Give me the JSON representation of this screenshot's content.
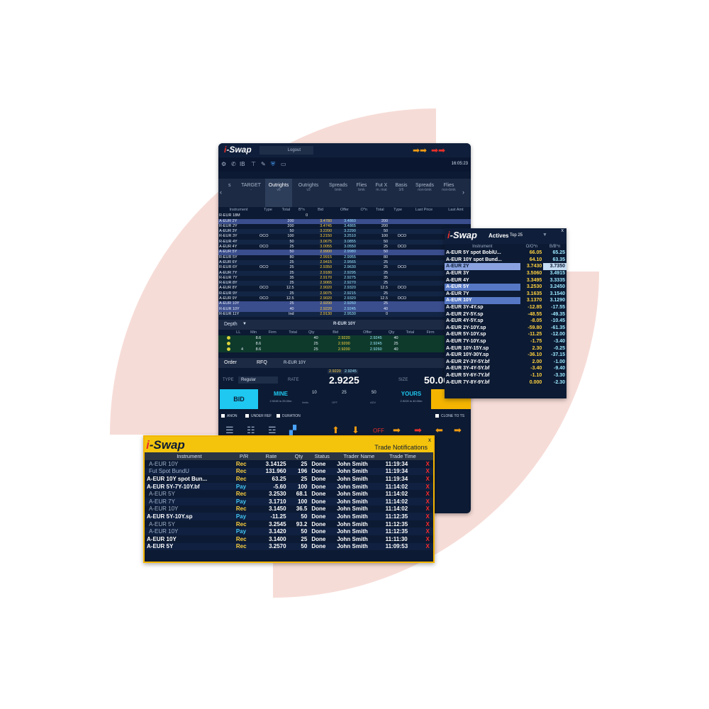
{
  "main": {
    "logo": {
      "i": "i",
      "rest": "-Swap"
    },
    "logout_label": "Logout",
    "clock": "16:05:23",
    "tabs": [
      {
        "label": "s",
        "sub": ""
      },
      {
        "label": "TARGET",
        "sub": "-"
      },
      {
        "label": "Outrights",
        "sub": "v6"
      },
      {
        "label": "Outrights",
        "sub": "v3"
      },
      {
        "label": "Spreads",
        "sub": "bmk"
      },
      {
        "label": "Flies",
        "sub": "bmk"
      },
      {
        "label": "Fut X",
        "sub": "m. mat"
      },
      {
        "label": "Basis",
        "sub": "3/6"
      },
      {
        "label": "Spreads",
        "sub": "non-bmk"
      },
      {
        "label": "Flies",
        "sub": "non-bmk"
      }
    ],
    "grid_headers": [
      "Instrument",
      "Type",
      "Total",
      "B*n",
      "Bid",
      "Offer",
      "O*n",
      "Total",
      "Type",
      "Last Price",
      "Last Amt"
    ],
    "grid_rows": [
      [
        "R-EUR 18M",
        "",
        "",
        "0",
        "",
        "",
        "",
        "",
        "",
        "",
        ""
      ],
      [
        "A-EUR 2Y",
        "",
        "200",
        "",
        "3.4780",
        "3.4860",
        "",
        "200",
        "",
        "",
        ""
      ],
      [
        "R-EUR 2Y",
        "",
        "200",
        "",
        "3.4745",
        "3.4865",
        "",
        "200",
        "",
        "",
        ""
      ],
      [
        "A-EUR 3Y",
        "",
        "50",
        "",
        "3.2200",
        "3.2290",
        "",
        "50",
        "",
        "",
        ""
      ],
      [
        "R-EUR 3Y",
        "OCO",
        "100",
        "",
        "3.2150",
        "3.2510",
        "",
        "100",
        "OCO",
        "",
        ""
      ],
      [
        "R-EUR 4Y",
        "",
        "50",
        "",
        "3.0675",
        "3.0855",
        "",
        "50",
        "",
        "",
        ""
      ],
      [
        "A-EUR 4Y",
        "OCO",
        "25",
        "",
        "3.0055",
        "3.0550",
        "",
        "25",
        "OCO",
        "",
        ""
      ],
      [
        "A-EUR 5Y",
        "",
        "50",
        "",
        "2.9900",
        "2.9980",
        "",
        "50",
        "",
        "",
        ""
      ],
      [
        "R-EUR 5Y",
        "",
        "80",
        "",
        "2.9915",
        "2.9955",
        "",
        "80",
        "",
        "",
        ""
      ],
      [
        "A-EUR 6Y",
        "",
        "25",
        "",
        "2.9415",
        "2.9565",
        "",
        "25",
        "",
        "",
        ""
      ],
      [
        "R-EUR 6Y",
        "OCO",
        "25",
        "",
        "2.9350",
        "2.9630",
        "",
        "25",
        "OCO",
        "",
        ""
      ],
      [
        "A-EUR 7Y",
        "",
        "25",
        "",
        "2.9180",
        "2.9295",
        "",
        "25",
        "",
        "",
        ""
      ],
      [
        "R-EUR 7Y",
        "",
        "35",
        "",
        "2.9170",
        "2.9275",
        "",
        "35",
        "",
        "",
        ""
      ],
      [
        "R-EUR 8Y",
        "",
        "25",
        "",
        "2.9065",
        "2.9270",
        "",
        "25",
        "",
        "",
        ""
      ],
      [
        "A-EUR 8Y",
        "OCO",
        "12.5",
        "",
        "2.9020",
        "2.9320",
        "",
        "12.5",
        "OCO",
        "",
        ""
      ],
      [
        "R-EUR 9Y",
        "",
        "25",
        "",
        "2.9075",
        "2.9215",
        "",
        "25",
        "",
        "",
        ""
      ],
      [
        "A-EUR 9Y",
        "OCO",
        "12.5",
        "",
        "2.9020",
        "2.9320",
        "",
        "12.5",
        "OCO",
        "",
        ""
      ],
      [
        "A-EUR 10Y",
        "",
        "25",
        "",
        "2.9200",
        "2.9260",
        "",
        "25",
        "",
        "",
        ""
      ],
      [
        "R-EUR 10Y",
        "",
        "40",
        "",
        "2.9220",
        "2.9245",
        "",
        "40",
        "",
        "",
        ""
      ],
      [
        "R-EUR 11Y",
        "",
        "Ind",
        "",
        "2.9130",
        "2.9530",
        "",
        "0",
        "",
        "",
        ""
      ]
    ],
    "depth_label": "Depth",
    "depth_instrument": "R-EUR 10Y",
    "depth_headers": [
      "LL",
      "Min",
      "Firm",
      "Total",
      "Qty",
      "Bid",
      "Offer",
      "Qty",
      "Total",
      "Firm",
      "Min",
      "LL"
    ],
    "depth_rows": [
      [
        "",
        "8.6",
        "",
        "",
        "40",
        "2.9220",
        "2.9245",
        "40",
        "",
        "",
        "8.6",
        ""
      ],
      [
        "",
        "8.6",
        "",
        "",
        "25",
        "2.9200",
        "2.9245",
        "25",
        "",
        "",
        "8.6",
        ""
      ],
      [
        "4",
        "8.6",
        "",
        "",
        "25",
        "2.9200",
        "2.9260",
        "40",
        "",
        "",
        "8.6",
        ""
      ]
    ],
    "order_tabs": [
      "Order",
      "RFQ"
    ],
    "order_instrument": "R-EUR 10Y",
    "best_bid": "2.9220",
    "best_offer": "2.9245",
    "type_label": "TYPE",
    "type_value": "Regular",
    "rate_label": "RATE",
    "rate_value": "2.9225",
    "size_label": "SIZE",
    "size_value": "50.00",
    "bid_label": "BID",
    "mine_label": "MINE",
    "mine_sub": "2.9245 in 25.00m",
    "yours_label": "YOURS",
    "yours_sub": "2.9220 in 40.00m",
    "size_choices": [
      "10",
      "25",
      "50"
    ],
    "small_labels": [
      "limits",
      "OFF",
      "ADV"
    ],
    "checkboxes": [
      "ANON",
      "UNDER REF",
      "DURATION",
      "CLONE TO TS"
    ],
    "off_label": "OFF"
  },
  "actives": {
    "logo": {
      "i": "i",
      "rest": "-Swap"
    },
    "tab": "Actives",
    "tab2": "Top 25",
    "headers": [
      "Instrument",
      "O/O*n",
      "B/B*n"
    ],
    "rows": [
      {
        "name": "A-EUR 5Y spot BoblU...",
        "o": "66.05",
        "b": "65.25",
        "hl": ""
      },
      {
        "name": "A-EUR 10Y spot Bund...",
        "o": "64.10",
        "b": "63.35",
        "hl": ""
      },
      {
        "name": "A-EUR 2Y",
        "o": "3.7430",
        "b": "3.7350",
        "hl": "hl"
      },
      {
        "name": "A-EUR 3Y",
        "o": "3.5060",
        "b": "3.4915",
        "hl": ""
      },
      {
        "name": "A-EUR 4Y",
        "o": "3.3495",
        "b": "3.3335",
        "hl": ""
      },
      {
        "name": "A-EUR 5Y",
        "o": "3.2530",
        "b": "3.2450",
        "hl": "hl2"
      },
      {
        "name": "A-EUR 7Y",
        "o": "3.1635",
        "b": "3.1540",
        "hl": ""
      },
      {
        "name": "A-EUR 10Y",
        "o": "3.1370",
        "b": "3.1290",
        "hl": "hl2"
      },
      {
        "name": "A-EUR 3Y-4Y.sp",
        "o": "-12.85",
        "b": "-17.55",
        "hl": ""
      },
      {
        "name": "A-EUR 2Y-5Y.sp",
        "o": "-48.55",
        "b": "-49.35",
        "hl": ""
      },
      {
        "name": "A-EUR 4Y-5Y.sp",
        "o": "-8.05",
        "b": "-10.45",
        "hl": ""
      },
      {
        "name": "A-EUR 2Y-10Y.sp",
        "o": "-59.80",
        "b": "-61.35",
        "hl": ""
      },
      {
        "name": "A-EUR 5Y-10Y.sp",
        "o": "-11.25",
        "b": "-12.00",
        "hl": ""
      },
      {
        "name": "A-EUR 7Y-10Y.sp",
        "o": "-1.75",
        "b": "-3.40",
        "hl": ""
      },
      {
        "name": "A-EUR 10Y-15Y.sp",
        "o": "2.30",
        "b": "-0.25",
        "hl": ""
      },
      {
        "name": "A-EUR 10Y-30Y.sp",
        "o": "-36.10",
        "b": "-37.15",
        "hl": ""
      },
      {
        "name": "A-EUR 2Y-3Y-5Y.bf",
        "o": "2.00",
        "b": "-1.00",
        "hl": ""
      },
      {
        "name": "A-EUR 3Y-4Y-5Y.bf",
        "o": "-3.40",
        "b": "-9.40",
        "hl": ""
      },
      {
        "name": "A-EUR 5Y-6Y-7Y.bf",
        "o": "-1.10",
        "b": "-3.30",
        "hl": ""
      },
      {
        "name": "A-EUR 7Y-8Y-9Y.bf",
        "o": "0.000",
        "b": "-2.30",
        "hl": ""
      }
    ]
  },
  "trades": {
    "logo": {
      "i": "i",
      "rest": "-Swap"
    },
    "title": "Trade Notifications",
    "close": "x",
    "headers": [
      "Instrument",
      "P/R",
      "Rate",
      "Qty",
      "Status",
      "Trader Name",
      "Trade Time",
      ""
    ],
    "rows": [
      {
        "inst": "A-EUR 10Y",
        "pr": "Rec",
        "rate": "3.14125",
        "qty": "25",
        "status": "Done",
        "trader": "John Smith",
        "time": "11:19:34",
        "dim": true
      },
      {
        "inst": "Fut Spot BundU",
        "pr": "Rec",
        "rate": "131.960",
        "qty": "196",
        "status": "Done",
        "trader": "John Smith",
        "time": "11:19:34",
        "dim": true
      },
      {
        "inst": "A-EUR 10Y spot Bun...",
        "pr": "Rec",
        "rate": "63.25",
        "qty": "25",
        "status": "Done",
        "trader": "John Smith",
        "time": "11:19:34",
        "dim": false
      },
      {
        "inst": "A-EUR 5Y-7Y-10Y.bf",
        "pr": "Pay",
        "rate": "-5.60",
        "qty": "100",
        "status": "Done",
        "trader": "John Smith",
        "time": "11:14:02",
        "dim": false
      },
      {
        "inst": "A-EUR 5Y",
        "pr": "Rec",
        "rate": "3.2530",
        "qty": "68.1",
        "status": "Done",
        "trader": "John Smith",
        "time": "11:14:02",
        "dim": true
      },
      {
        "inst": "A-EUR 7Y",
        "pr": "Pay",
        "rate": "3.1710",
        "qty": "100",
        "status": "Done",
        "trader": "John Smith",
        "time": "11:14:02",
        "dim": true
      },
      {
        "inst": "A-EUR 10Y",
        "pr": "Rec",
        "rate": "3.1450",
        "qty": "36.5",
        "status": "Done",
        "trader": "John Smith",
        "time": "11:14:02",
        "dim": true
      },
      {
        "inst": "A-EUR 5Y-10Y.sp",
        "pr": "Pay",
        "rate": "-11.25",
        "qty": "50",
        "status": "Done",
        "trader": "John Smith",
        "time": "11:12:35",
        "dim": false
      },
      {
        "inst": "A-EUR 5Y",
        "pr": "Rec",
        "rate": "3.2545",
        "qty": "93.2",
        "status": "Done",
        "trader": "John Smith",
        "time": "11:12:35",
        "dim": true
      },
      {
        "inst": "A-EUR 10Y",
        "pr": "Pay",
        "rate": "3.1420",
        "qty": "50",
        "status": "Done",
        "trader": "John Smith",
        "time": "11:12:35",
        "dim": true
      },
      {
        "inst": "A-EUR 10Y",
        "pr": "Rec",
        "rate": "3.1400",
        "qty": "25",
        "status": "Done",
        "trader": "John Smith",
        "time": "11:11:30",
        "dim": false
      },
      {
        "inst": "A-EUR 5Y",
        "pr": "Rec",
        "rate": "3.2570",
        "qty": "50",
        "status": "Done",
        "trader": "John Smith",
        "time": "11:09:53",
        "dim": false
      }
    ],
    "x_mark": "X"
  },
  "colors": {
    "accent": "#f4c40d",
    "bid": "#ffd23f",
    "offer": "#9be8ff",
    "bg": "#0c1a33",
    "brand_red": "#e8302a",
    "shape": "#f6dcd7"
  }
}
